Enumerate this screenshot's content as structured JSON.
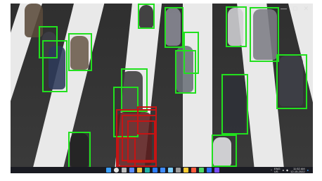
{
  "window": {
    "min_label": "—",
    "max_label": "□",
    "close_label": "✕"
  },
  "taskbar": {
    "icons": [
      "windows-start-icon",
      "search-icon",
      "task-view-icon",
      "widgets-icon",
      "file-explorer-icon",
      "edge-icon",
      "store-icon",
      "mail-icon",
      "photos-icon",
      "settings-icon",
      "app-icon-1",
      "app-icon-2",
      "app-icon-3",
      "app-icon-4",
      "app-icon-5"
    ],
    "tray": {
      "chevron": "^",
      "lang": "ENG\nUS",
      "time": "11:52 AM",
      "date": "12-15-2022"
    }
  },
  "colors": {
    "detection_box": "#22e01f",
    "tracked_box": "#c51414",
    "taskbar_bg": "#1a1b22"
  }
}
